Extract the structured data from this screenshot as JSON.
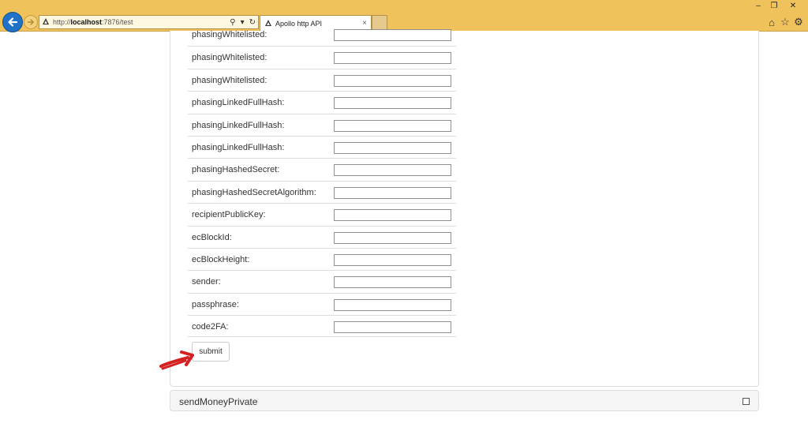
{
  "browser": {
    "address_prefix": "http://",
    "address_host": "localhost",
    "address_rest": ":7876/test",
    "tab_title": "Apollo http API",
    "tab_close": "×",
    "back_glyph": "←",
    "forward_glyph": "→",
    "search_glyph": "⚲",
    "dropdown_glyph": "▾",
    "refresh_glyph": "↻",
    "window_min": "–",
    "window_restore": "❐",
    "window_close": "✕",
    "home_glyph": "⌂",
    "favorites_glyph": "☆",
    "tools_glyph": "⚙"
  },
  "form": {
    "rows": [
      {
        "label": "phasingWhitelisted:",
        "value": ""
      },
      {
        "label": "phasingWhitelisted:",
        "value": ""
      },
      {
        "label": "phasingWhitelisted:",
        "value": ""
      },
      {
        "label": "phasingLinkedFullHash:",
        "value": ""
      },
      {
        "label": "phasingLinkedFullHash:",
        "value": ""
      },
      {
        "label": "phasingLinkedFullHash:",
        "value": ""
      },
      {
        "label": "phasingHashedSecret:",
        "value": ""
      },
      {
        "label": "phasingHashedSecretAlgorithm:",
        "value": ""
      },
      {
        "label": "recipientPublicKey:",
        "value": ""
      },
      {
        "label": "ecBlockId:",
        "value": ""
      },
      {
        "label": "ecBlockHeight:",
        "value": ""
      },
      {
        "label": "sender:",
        "value": ""
      },
      {
        "label": "passphrase:",
        "value": ""
      },
      {
        "label": "code2FA:",
        "value": ""
      }
    ],
    "submit_label": "submit"
  },
  "next_panel": {
    "title": "sendMoneyPrivate",
    "checked": false
  },
  "colors": {
    "chrome_bg": "#f0c25c",
    "back_button": "#1f72c7",
    "annotation_arrow": "#d42020"
  }
}
